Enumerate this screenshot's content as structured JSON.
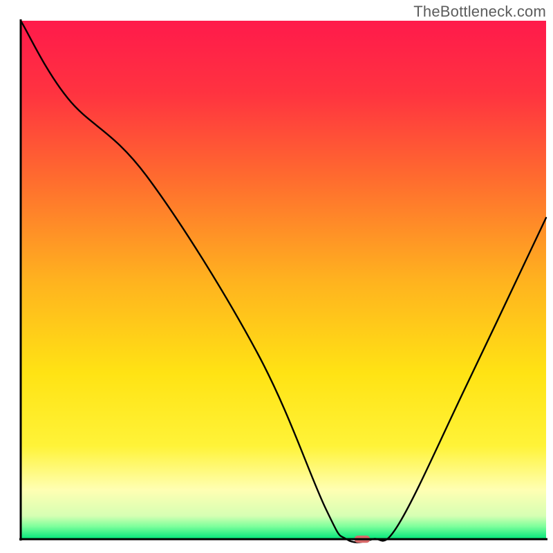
{
  "watermark": "TheBottleneck.com",
  "chart_data": {
    "type": "line",
    "title": "",
    "xlabel": "",
    "ylabel": "",
    "xlim": [
      0,
      100
    ],
    "ylim": [
      0,
      100
    ],
    "background": {
      "type": "vertical-gradient",
      "description": "Smooth red→orange→yellow gradient over most of the height, pale-yellow band, then thin green band at the bottom.",
      "stops": [
        {
          "offset": 0.0,
          "color": "#ff1a4b"
        },
        {
          "offset": 0.14,
          "color": "#ff3340"
        },
        {
          "offset": 0.3,
          "color": "#ff6a2f"
        },
        {
          "offset": 0.5,
          "color": "#ffb21f"
        },
        {
          "offset": 0.68,
          "color": "#ffe314"
        },
        {
          "offset": 0.82,
          "color": "#fff338"
        },
        {
          "offset": 0.905,
          "color": "#ffffb3"
        },
        {
          "offset": 0.955,
          "color": "#d6ffb3"
        },
        {
          "offset": 0.975,
          "color": "#7fff9c"
        },
        {
          "offset": 1.0,
          "color": "#00e57a"
        }
      ]
    },
    "series": [
      {
        "name": "bottleneck-curve",
        "color": "#000000",
        "stroke_width": 2.4,
        "x": [
          0,
          9,
          24,
          45,
          58,
          62,
          67,
          72,
          85,
          100
        ],
        "values": [
          100,
          85,
          70,
          36,
          6,
          0,
          0,
          3,
          30,
          62
        ]
      }
    ],
    "marker": {
      "name": "optimal-point",
      "x": 65,
      "y": 0,
      "shape": "rounded-rect",
      "color": "#d96a6a",
      "width_pct": 3.0,
      "height_pct": 1.4
    },
    "axes": {
      "color": "#000000",
      "width": 3
    }
  }
}
